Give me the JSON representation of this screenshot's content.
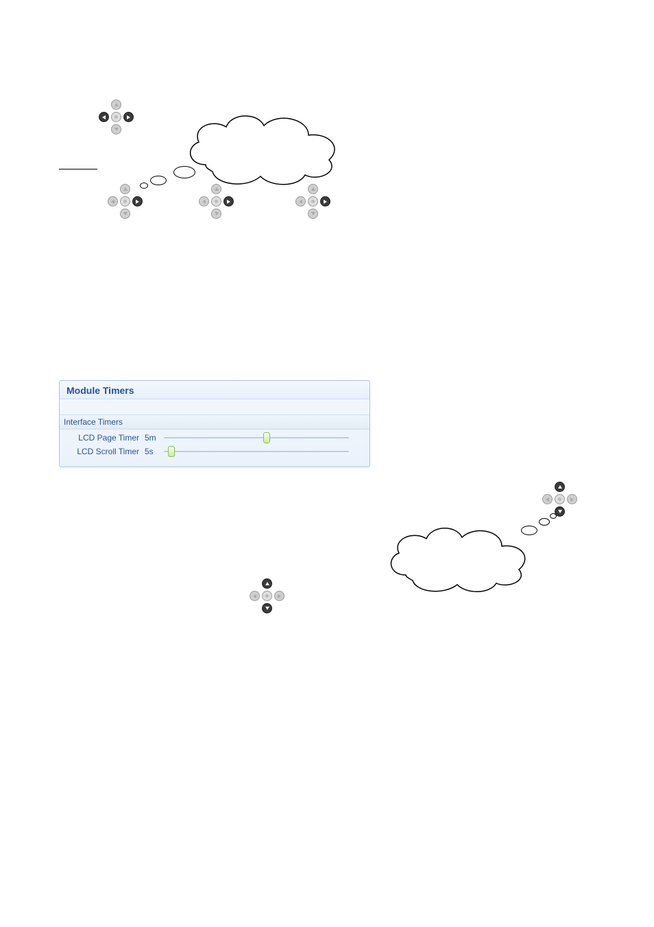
{
  "panel": {
    "title": "Module Timers",
    "subtitle": "Interface Timers",
    "rows": [
      {
        "label": "LCD Page Timer",
        "value": "5m"
      },
      {
        "label": "LCD Scroll Timer",
        "value": "5s"
      }
    ]
  }
}
